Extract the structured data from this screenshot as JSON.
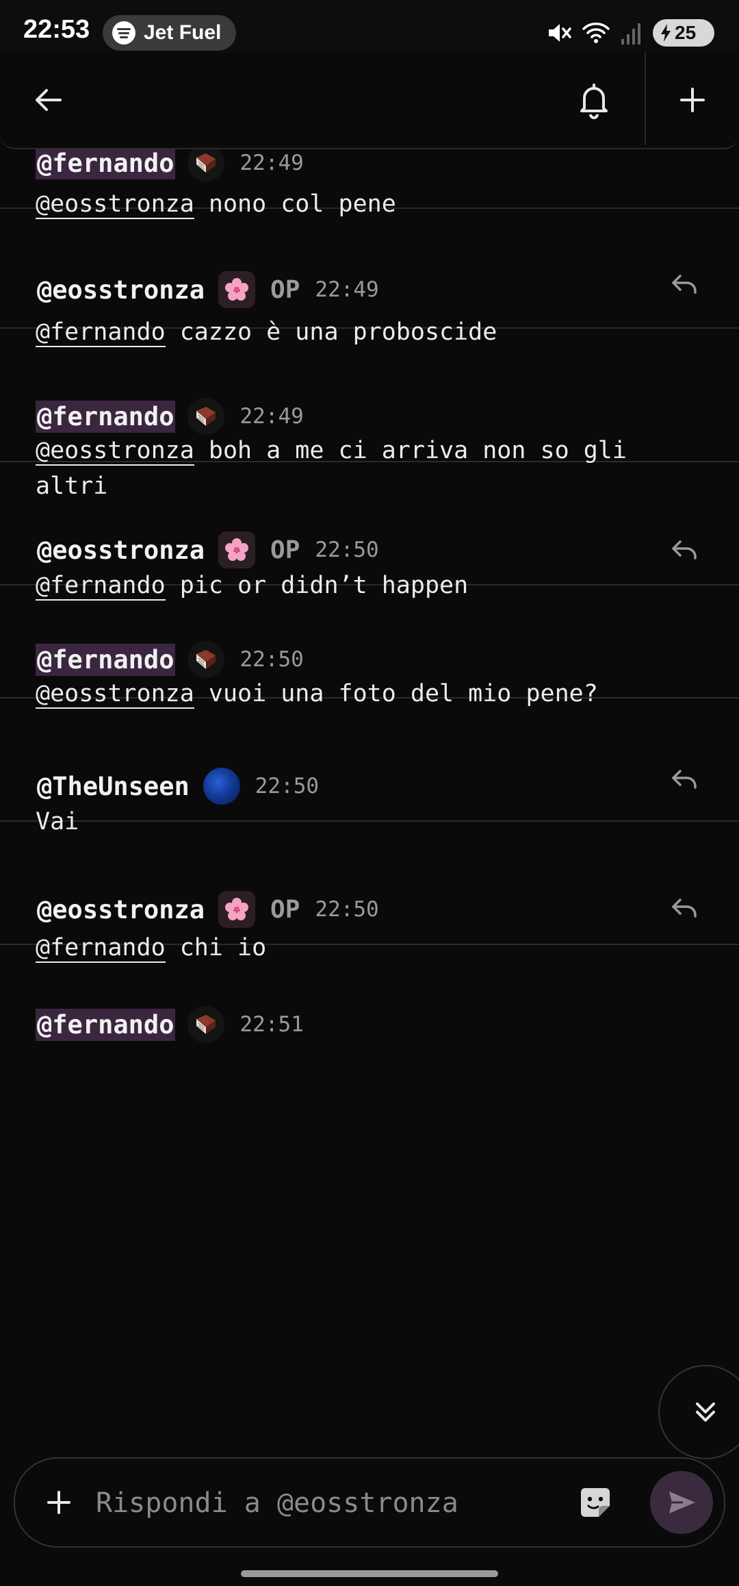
{
  "status_bar": {
    "time": "22:53",
    "media_pill": {
      "app_icon": "spotify-icon",
      "title": "Jet Fuel"
    },
    "icons": [
      "mute-icon",
      "wifi-icon",
      "signal-icon"
    ],
    "battery": "25"
  },
  "toolbar": {
    "back_icon": "arrow-left-icon",
    "bell_icon": "bell-icon",
    "add_icon": "plus-icon"
  },
  "messages": [
    {
      "user": "@fernando",
      "avatar": "book-avatar",
      "highlighted": true,
      "op": "",
      "time": "22:49",
      "mention": "@eosstronza",
      "text": " nono col pene",
      "reply": false
    },
    {
      "user": "@eosstronza",
      "avatar": "flower-avatar",
      "highlighted": false,
      "op": "OP",
      "time": "22:49",
      "mention": "@fernando",
      "text": " cazzo è una proboscide",
      "reply": true
    },
    {
      "user": "@fernando",
      "avatar": "book-avatar",
      "highlighted": true,
      "op": "",
      "time": "22:49",
      "mention": "@eosstronza",
      "text": " boh a me ci arriva non so gli altri",
      "reply": false
    },
    {
      "user": "@eosstronza",
      "avatar": "flower-avatar",
      "highlighted": false,
      "op": "OP",
      "time": "22:50",
      "mention": "@fernando",
      "text": " pic or didn’t happen",
      "reply": true
    },
    {
      "user": "@fernando",
      "avatar": "book-avatar",
      "highlighted": true,
      "op": "",
      "time": "22:50",
      "mention": "@eosstronza",
      "text": " vuoi una foto del mio pene?",
      "reply": false
    },
    {
      "user": "@TheUnseen",
      "avatar": "blue-avatar",
      "highlighted": false,
      "op": "",
      "time": "22:50",
      "mention": "",
      "text": "Vai",
      "reply": true
    },
    {
      "user": "@eosstronza",
      "avatar": "flower-avatar",
      "highlighted": false,
      "op": "OP",
      "time": "22:50",
      "mention": "@fernando",
      "text": " chi io",
      "reply": true
    },
    {
      "user": "@fernando",
      "avatar": "book-avatar",
      "highlighted": true,
      "op": "",
      "time": "22:51",
      "mention": "",
      "text": "",
      "reply": false
    }
  ],
  "composer": {
    "placeholder": "Rispondi a @eosstronza",
    "add_icon": "plus-icon",
    "sticker_icon": "sticker-icon",
    "send_icon": "send-icon"
  },
  "scroll_button_icon": "double-chevron-down-icon",
  "colors": {
    "background": "#0a0a0a",
    "highlight": "#3b2640",
    "divider": "#2a2a2a",
    "muted": "#9a9a9a",
    "send_button": "#3a2a3e"
  }
}
